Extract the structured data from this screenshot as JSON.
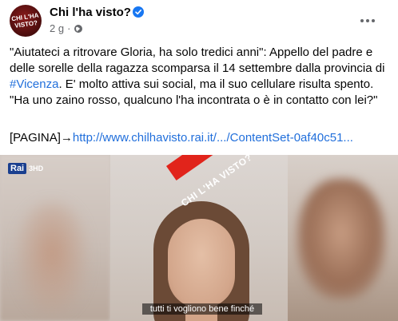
{
  "header": {
    "avatar_text": "CHI L'HA VISTO?",
    "page_name": "Chi l'ha visto?",
    "timestamp": "2 g",
    "separator": "·"
  },
  "post": {
    "text_1": "\"Aiutateci a ritrovare Gloria, ha solo tredici anni\": Appello del padre e delle sorelle della ragazza scomparsa il 14 settembre dalla provincia di ",
    "hashtag": "#Vicenza",
    "text_2": ". E' molto attiva sui social, ma il suo cellulare risulta spento. \"Ha uno zaino rosso, qualcuno l'ha incontrata o è in contatto con lei?\"",
    "link_prefix": "[PAGINA]→",
    "link_text": "http://www.chilhavisto.rai.it/.../ContentSet-0af40c51..."
  },
  "media": {
    "channel_logo": "Rai",
    "channel_number": "3HD",
    "banner_text": "CHI L'HA VISTO?",
    "subtitle": "tutti ti vogliono bene finché"
  },
  "colors": {
    "accent": "#1877f2",
    "link": "#216fdb",
    "meta": "#65676b",
    "banner": "#e1241b"
  },
  "icons": {
    "verified": "verified-badge-icon",
    "audience": "globe-icon",
    "more": "more-options-icon"
  }
}
